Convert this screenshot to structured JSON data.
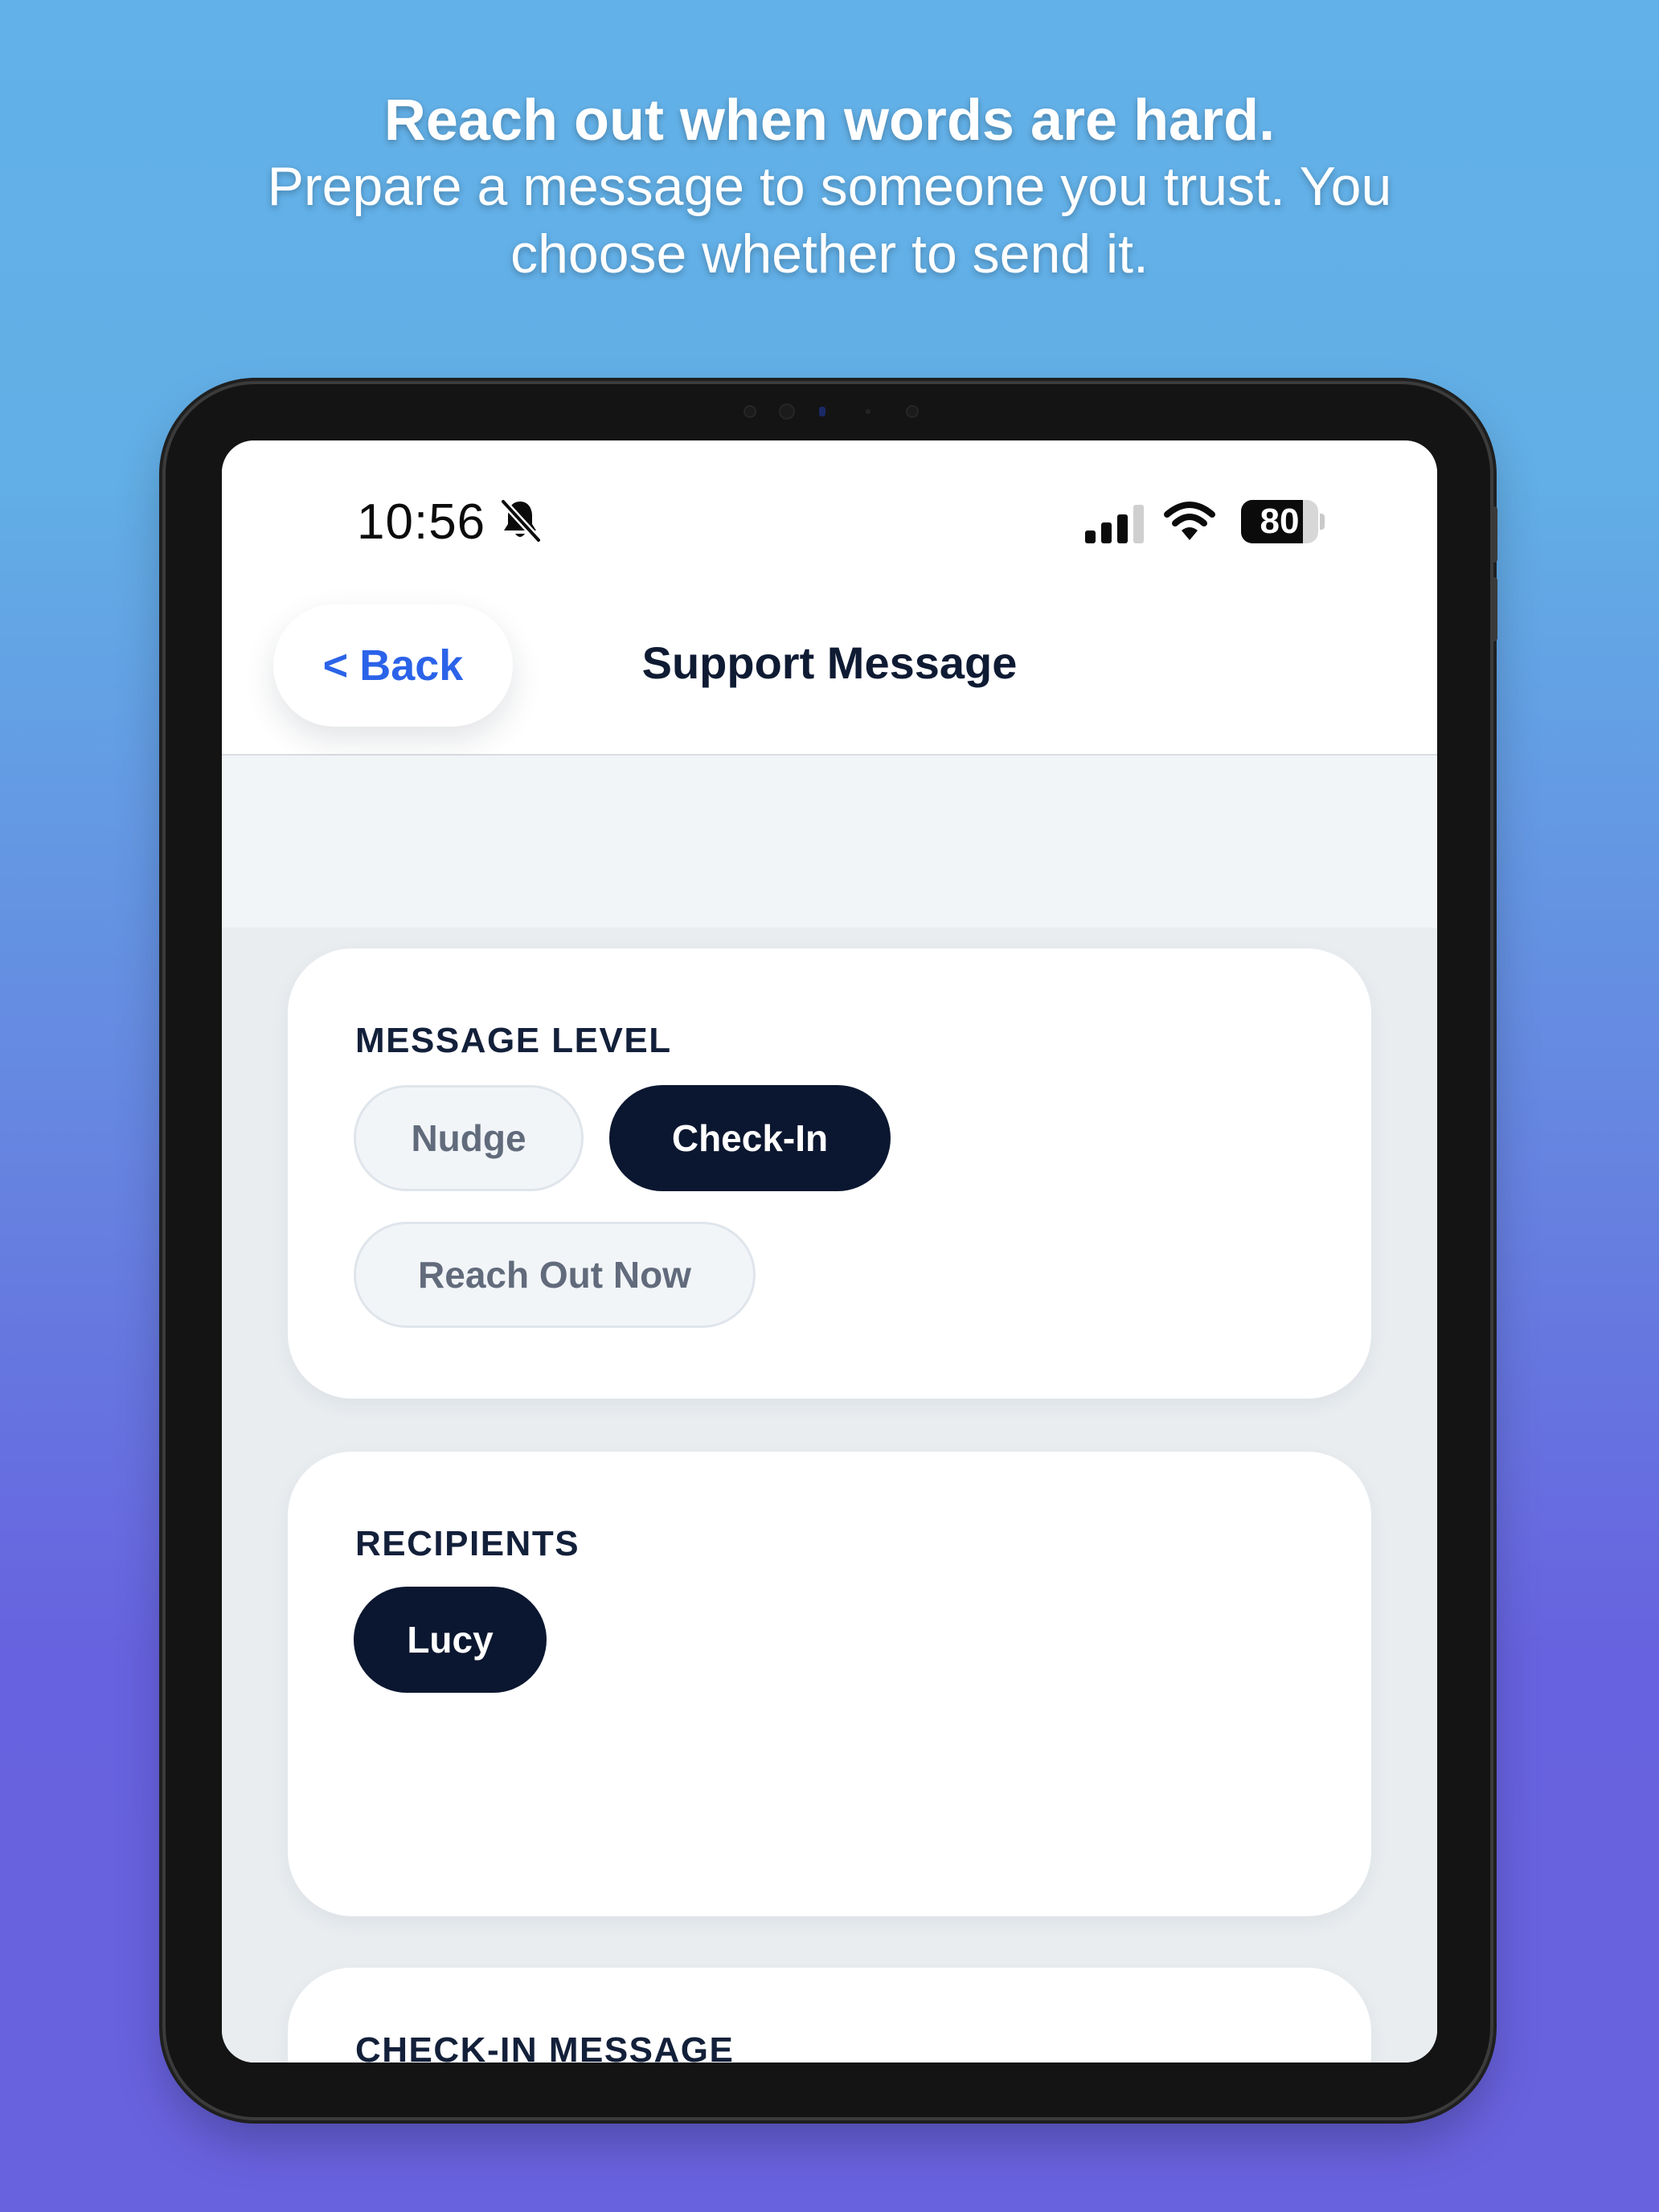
{
  "promo": {
    "headline": "Reach out when words are hard.",
    "subheadline": "Prepare a message to someone you trust. You choose whether to send it."
  },
  "status_bar": {
    "time": "10:56",
    "silent_icon": "bell-slash-icon",
    "signal_icon": "cellular-signal-icon",
    "wifi_icon": "wifi-icon",
    "battery_percent": "80",
    "battery_level": 0.8
  },
  "nav": {
    "back_chevron": "<",
    "back_label": "Back",
    "title": "Support Message"
  },
  "message_level": {
    "label": "MESSAGE LEVEL",
    "options": [
      {
        "label": "Nudge",
        "selected": false
      },
      {
        "label": "Check-In",
        "selected": true
      },
      {
        "label": "Reach Out Now",
        "selected": false
      }
    ]
  },
  "recipients": {
    "label": "RECIPIENTS",
    "items": [
      {
        "label": "Lucy",
        "selected": true
      }
    ]
  },
  "checkin_message": {
    "label": "CHECK-IN MESSAGE"
  },
  "colors": {
    "accent_blue": "#2b63e9",
    "chip_selected": "#0b1730",
    "title_dark": "#0f1b33"
  }
}
